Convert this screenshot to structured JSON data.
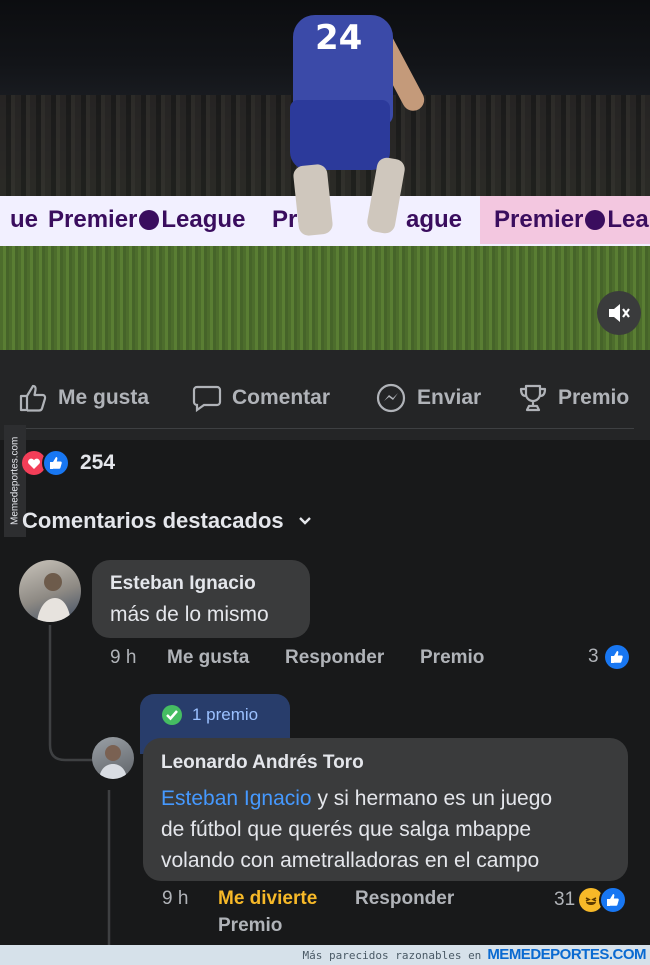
{
  "video": {
    "jersey_number": "24",
    "board_text_1": "Premier",
    "board_text_2": "League",
    "board_text_3": "Pre",
    "board_text_4": "ague",
    "board_text_5": "Premier",
    "board_text_6": "Lea",
    "board_edge": "ue"
  },
  "actions": {
    "like": "Me gusta",
    "comment": "Comentar",
    "send": "Enviar",
    "award": "Premio"
  },
  "reactions": {
    "count": "254"
  },
  "watermark_side": "Memedeportes.com",
  "comments_header": "Comentarios destacados",
  "comment1": {
    "author": "Esteban Ignacio",
    "text": "más de lo mismo",
    "time": "9 h",
    "like": "Me gusta",
    "reply": "Responder",
    "award": "Premio",
    "reaction_count": "3"
  },
  "reply1": {
    "award_badge": "1 premio",
    "author": "Leonardo Andrés Toro",
    "mention": "Esteban Ignacio",
    "text_line1": " y si hermano es un juego",
    "text_line2": "de fútbol que querés que salga mbappe",
    "text_line3": "volando con ametralladoras en el campo",
    "time": "9 h",
    "reaction_label": "Me divierte",
    "reply": "Responder",
    "award": "Premio",
    "reaction_count": "31"
  },
  "footer": {
    "prefix": "Más parecidos razonables en",
    "site": "MEMEDEPORTES.COM"
  },
  "colors": {
    "background": "#18191a",
    "bubble": "#3a3b3c",
    "mention_blue": "#4599ff",
    "haha_label": "#f7b928",
    "like_blue": "#1877f2",
    "love_red": "#f33e58",
    "award_green": "#45bd62"
  }
}
